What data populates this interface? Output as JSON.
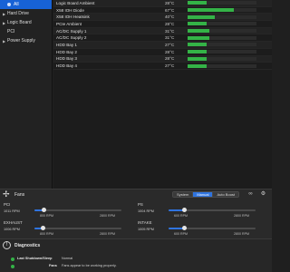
{
  "sidebar": {
    "items": [
      {
        "label": "All",
        "icon": "dot-icon",
        "selected": true
      },
      {
        "label": "Hard Drive",
        "icon": "hard-drive-icon",
        "selected": false
      },
      {
        "label": "Logic Board",
        "icon": "logic-board-icon",
        "selected": false
      },
      {
        "label": "PCI",
        "icon": "pci-icon",
        "selected": false
      },
      {
        "label": "Power Supply",
        "icon": "power-supply-icon",
        "selected": false
      }
    ]
  },
  "sensors": [
    {
      "name": "Logic Board Ambient",
      "value": "28°C",
      "level": 0.28
    },
    {
      "name": "X58 IOH Diode",
      "value": "67°C",
      "level": 0.67
    },
    {
      "name": "X58 IOH Heatsink",
      "value": "40°C",
      "level": 0.4
    },
    {
      "name": "PCIe Ambient",
      "value": "28°C",
      "level": 0.28
    },
    {
      "name": "AC/DC Supply 1",
      "value": "31°C",
      "level": 0.31
    },
    {
      "name": "AC/DC Supply 2",
      "value": "31°C",
      "level": 0.31
    },
    {
      "name": "HDD Bay 1",
      "value": "27°C",
      "level": 0.27
    },
    {
      "name": "HDD Bay 2",
      "value": "28°C",
      "level": 0.28
    },
    {
      "name": "HDD Bay 3",
      "value": "28°C",
      "level": 0.28
    },
    {
      "name": "HDD Bay 4",
      "value": "27°C",
      "level": 0.27
    }
  ],
  "fans": {
    "title": "Fans",
    "modes": [
      "System",
      "Manual",
      "Auto Boost"
    ],
    "selected_mode": "Manual",
    "items": [
      {
        "name": "PCI",
        "rpm": "1011 RPM",
        "min": "800 RPM",
        "max": "2800 RPM",
        "level": 0.11
      },
      {
        "name": "PS",
        "rpm": "1004 RPM",
        "min": "600 RPM",
        "max": "2800 RPM",
        "level": 0.18
      },
      {
        "name": "EXHAUST",
        "rpm": "1006 RPM",
        "min": "800 RPM",
        "max": "2800 RPM",
        "level": 0.1
      },
      {
        "name": "INTAKE",
        "rpm": "1005 RPM",
        "min": "600 RPM",
        "max": "2800 RPM",
        "level": 0.18
      }
    ]
  },
  "diagnostics": {
    "title": "Diagnostics",
    "rows": [
      {
        "label": "Last Shutdown/Sleep",
        "value": "Normal"
      },
      {
        "label": "Fans",
        "value": "Fans appear to be working properly."
      }
    ]
  },
  "colors": {
    "accent": "#2f74e0",
    "selection": "#1762d6",
    "ok_green": "#34b347"
  }
}
